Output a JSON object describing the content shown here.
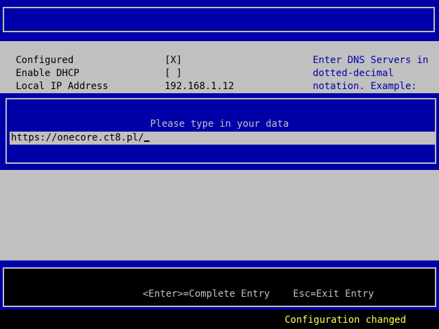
{
  "form": {
    "fields": [
      {
        "label": "Configured",
        "value": "[X]"
      },
      {
        "label": "Enable DHCP",
        "value": "[ ]"
      },
      {
        "label": "Local IP Address",
        "value": "192.168.1.12"
      }
    ],
    "help_lines": [
      "Enter DNS Servers in",
      "dotted-decimal",
      "notation. Example:"
    ]
  },
  "popup": {
    "prompt": "Please type in your data",
    "input_value": "https://onecore.ct8.pl/"
  },
  "footer": {
    "hint_enter": "<Enter>=Complete Entry",
    "hint_esc": "Esc=Exit Entry"
  },
  "status": {
    "message": "Configuration changed"
  },
  "colors": {
    "background_blue": "#0000a8",
    "form_gray": "#c0c0c0",
    "status_yellow": "#ffff55"
  }
}
